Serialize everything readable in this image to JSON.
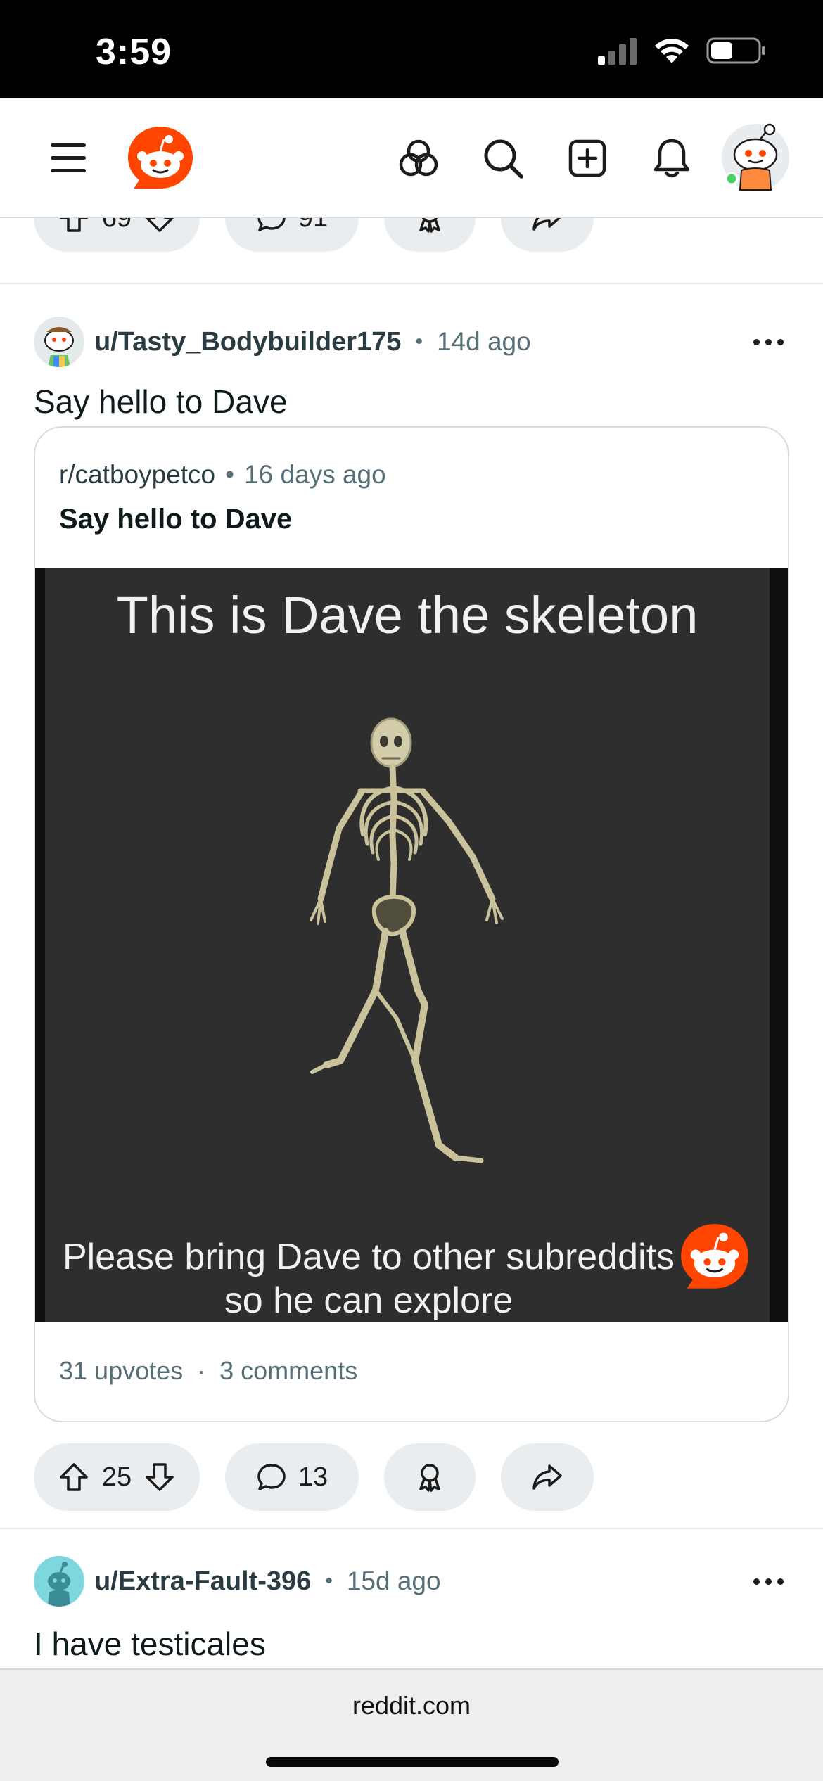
{
  "status_bar": {
    "time": "3:59"
  },
  "header": {
    "icons": [
      "menu-icon",
      "reddit-logo",
      "communities-icon",
      "search-icon",
      "create-post-icon",
      "notifications-icon",
      "profile-avatar"
    ]
  },
  "prev_post_actions": {
    "upvotes": "69",
    "comments": "91"
  },
  "post": {
    "author": "u/Tasty_Bodybuilder175",
    "age": "14d ago",
    "title": "Say hello to Dave",
    "crosspost": {
      "subreddit": "r/catboypetco",
      "age": "16 days ago",
      "title": "Say hello to Dave",
      "image_text_top": "This is Dave the skeleton",
      "image_text_bottom_line1": "Please bring Dave to other subreddits",
      "image_text_bottom_line2": "so he can explore",
      "upvotes": "31 upvotes",
      "comments": "3 comments"
    },
    "actions": {
      "upvotes": "25",
      "comments": "13"
    }
  },
  "next_post": {
    "author": "u/Extra-Fault-396",
    "age": "15d ago",
    "title": "I have testicales"
  },
  "browser": {
    "url": "reddit.com"
  },
  "colors": {
    "reddit_orange": "#ff4500",
    "pill_bg": "#eaedef",
    "meta_gray": "#576f76"
  }
}
